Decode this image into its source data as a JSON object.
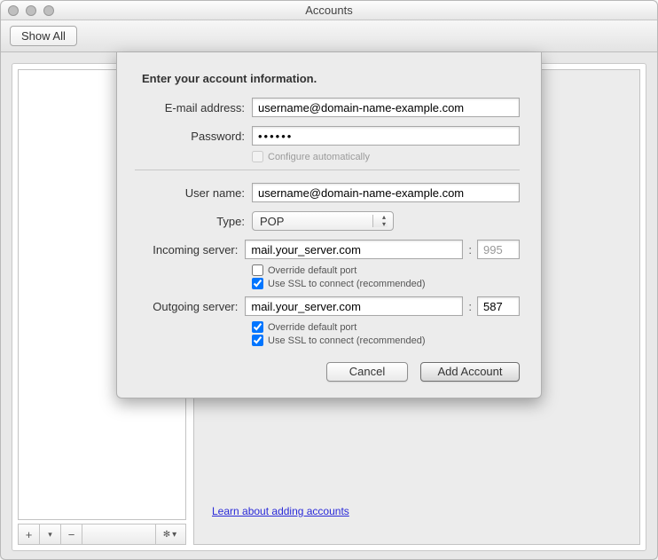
{
  "window": {
    "title": "Accounts"
  },
  "toolbar": {
    "show_all_label": "Show All"
  },
  "panel": {
    "learn_link": "Learn about adding accounts"
  },
  "sheet": {
    "heading": "Enter your account information.",
    "email_label": "E-mail address:",
    "email_value": "username@domain-name-example.com",
    "password_label": "Password:",
    "password_value": "••••••",
    "configure_auto_label": "Configure automatically",
    "configure_auto_checked": false,
    "username_label": "User name:",
    "username_value": "username@domain-name-example.com",
    "type_label": "Type:",
    "type_value": "POP",
    "incoming_label": "Incoming server:",
    "incoming_value": "mail.your_server.com",
    "incoming_port": "995",
    "incoming_override_label": "Override default port",
    "incoming_override_checked": false,
    "incoming_ssl_label": "Use SSL to connect (recommended)",
    "incoming_ssl_checked": true,
    "outgoing_label": "Outgoing server:",
    "outgoing_value": "mail.your_server.com",
    "outgoing_port": "587",
    "outgoing_override_label": "Override default port",
    "outgoing_override_checked": true,
    "outgoing_ssl_label": "Use SSL to connect (recommended)",
    "outgoing_ssl_checked": true,
    "cancel_label": "Cancel",
    "add_label": "Add Account"
  }
}
